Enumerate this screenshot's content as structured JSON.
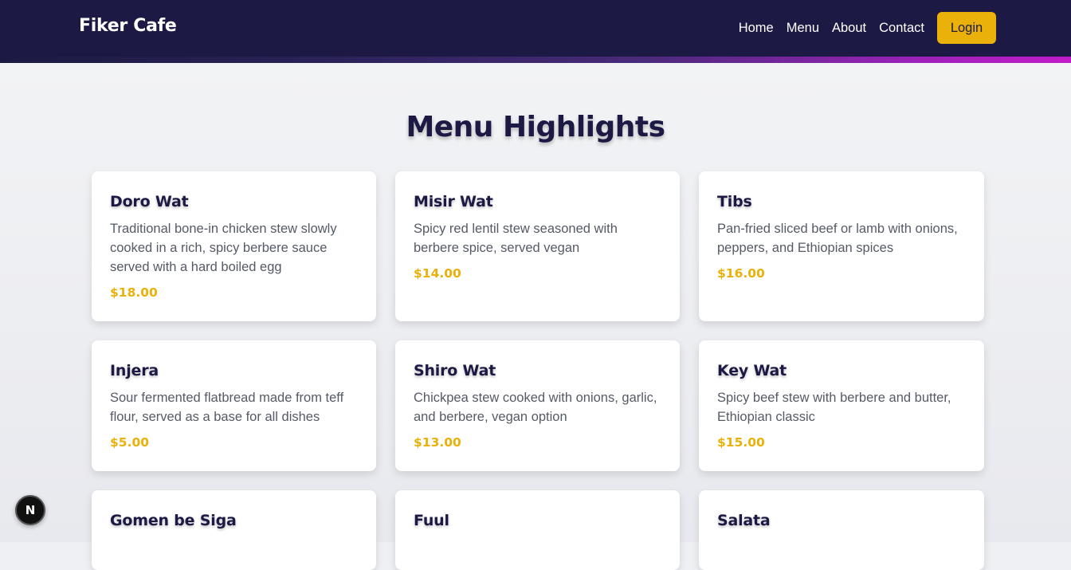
{
  "header": {
    "brand": "Fiker Cafe",
    "nav": [
      {
        "label": "Home"
      },
      {
        "label": "Menu"
      },
      {
        "label": "About"
      },
      {
        "label": "Contact"
      }
    ],
    "login_label": "Login"
  },
  "main": {
    "title": "Menu Highlights",
    "items": [
      {
        "name": "Doro Wat",
        "description": "Traditional bone-in chicken stew slowly cooked in a rich, spicy berbere sauce served with a hard boiled egg",
        "price": "$18.00"
      },
      {
        "name": "Misir Wat",
        "description": "Spicy red lentil stew seasoned with berbere spice, served vegan",
        "price": "$14.00"
      },
      {
        "name": "Tibs",
        "description": "Pan-fried sliced beef or lamb with onions, peppers, and Ethiopian spices",
        "price": "$16.00"
      },
      {
        "name": "Injera",
        "description": "Sour fermented flatbread made from teff flour, served as a base for all dishes",
        "price": "$5.00"
      },
      {
        "name": "Shiro Wat",
        "description": "Chickpea stew cooked with onions, garlic, and berbere, vegan option",
        "price": "$13.00"
      },
      {
        "name": "Key Wat",
        "description": "Spicy beef stew with berbere and butter, Ethiopian classic",
        "price": "$15.00"
      },
      {
        "name": "Gomen be Siga",
        "description": "",
        "price": ""
      },
      {
        "name": "Fuul",
        "description": "",
        "price": ""
      },
      {
        "name": "Salata",
        "description": "",
        "price": ""
      }
    ]
  },
  "dev_badge": {
    "letter": "N",
    "icon": "nextjs-icon"
  },
  "colors": {
    "navbar": "#1c1a44",
    "accent": "#e9b109",
    "title": "#1c1a44",
    "text": "#555a66"
  }
}
